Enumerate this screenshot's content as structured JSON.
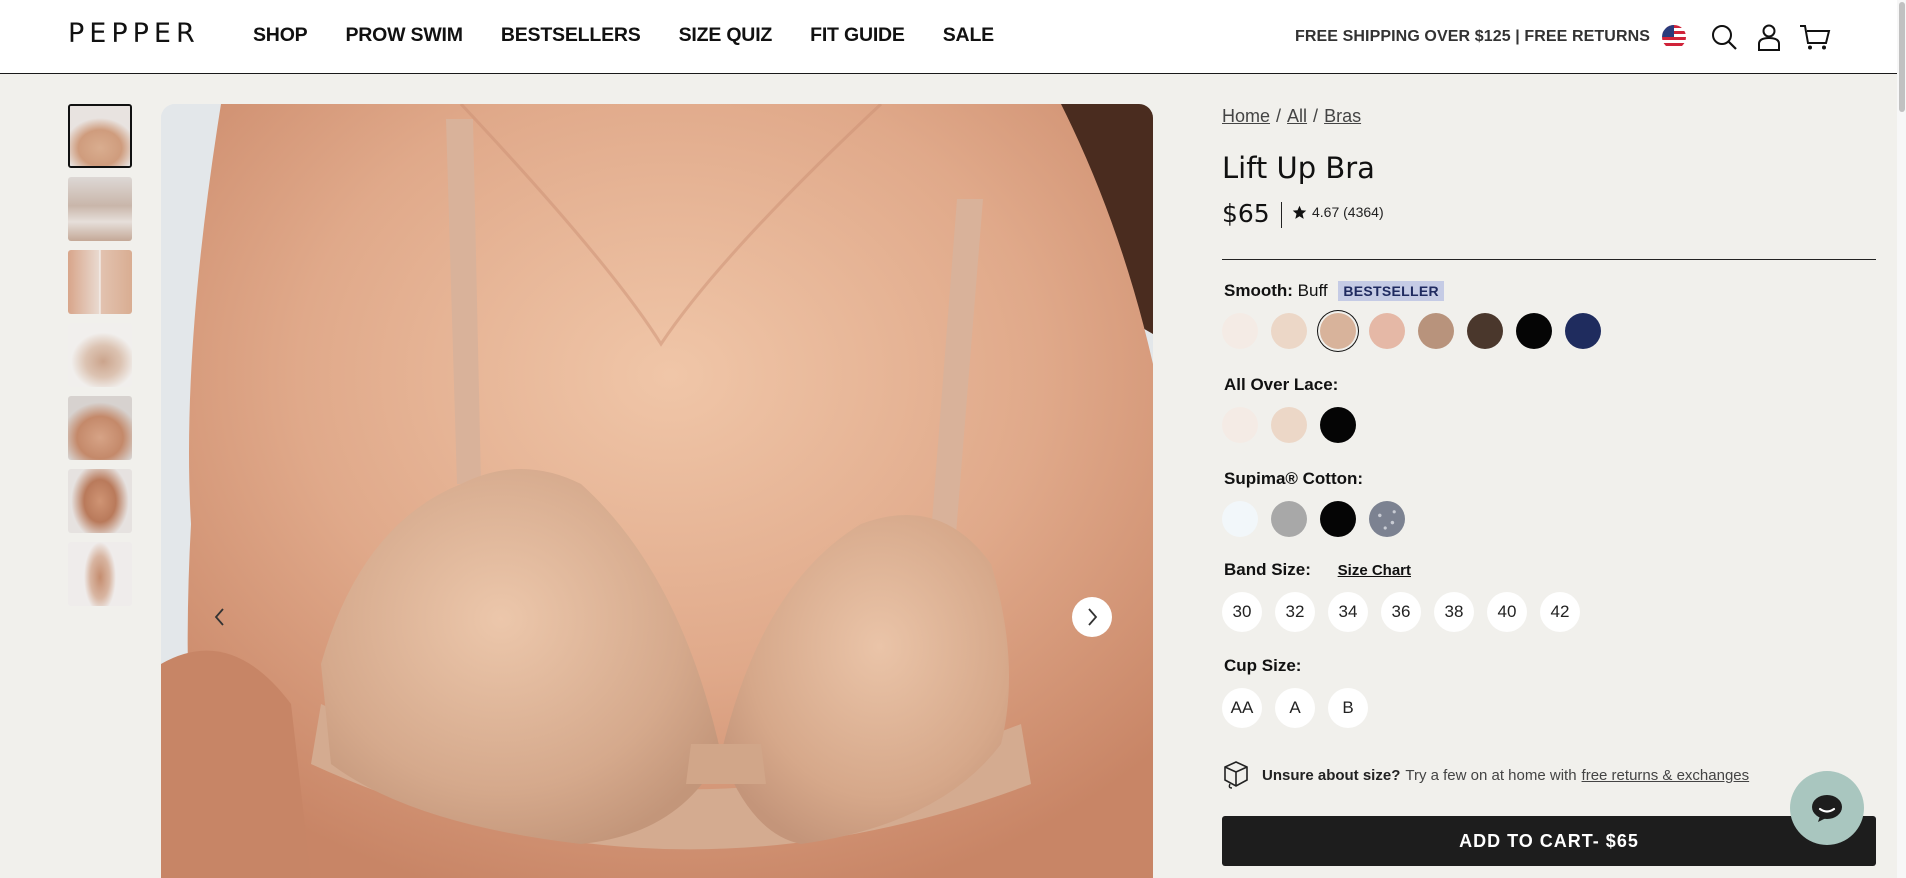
{
  "header": {
    "logo": "PEPPER",
    "nav": [
      "SHOP",
      "PROW SWIM",
      "BESTSELLERS",
      "SIZE QUIZ",
      "FIT GUIDE",
      "SALE"
    ],
    "promo": "FREE SHIPPING OVER $125 | FREE RETURNS",
    "icons": [
      "us-flag-icon",
      "search-icon",
      "account-icon",
      "cart-icon"
    ]
  },
  "gallery": {
    "thumb_count": 7,
    "active_thumb": 1
  },
  "breadcrumb": [
    "Home",
    "All",
    "Bras"
  ],
  "product": {
    "title": "Lift Up Bra",
    "price": "$65",
    "rating": "4.67 (4364)"
  },
  "smooth": {
    "label": "Smooth:",
    "selected": "Buff",
    "badge": "BESTSELLER",
    "colors": [
      "#f4ebe5",
      "#ecd7c7",
      "#d8b39b",
      "#e5b8a6",
      "#b8937c",
      "#4a372c",
      "#050505",
      "#1f2c5e"
    ],
    "selected_index": 2
  },
  "lace": {
    "label": "All Over Lace:",
    "colors": [
      "#f4ebe5",
      "#ecd7c7",
      "#050505"
    ]
  },
  "cotton": {
    "label": "Supima® Cotton:",
    "colors": [
      "#f2f7fa",
      "#a8a8a8",
      "#050505",
      "#7c8291"
    ]
  },
  "band": {
    "label": "Band Size:",
    "chart_link": "Size Chart",
    "sizes": [
      "30",
      "32",
      "34",
      "36",
      "38",
      "40",
      "42"
    ]
  },
  "cup": {
    "label": "Cup Size:",
    "sizes": [
      "AA",
      "A",
      "B"
    ]
  },
  "unsure": {
    "bold": "Unsure about size?",
    "text": "Try a few on at home with",
    "link": "free returns & exchanges"
  },
  "cart_button": "ADD TO CART- $65"
}
